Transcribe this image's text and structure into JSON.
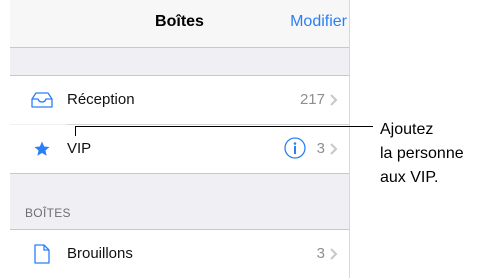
{
  "navbar": {
    "title": "Boîtes",
    "edit_label": "Modifier"
  },
  "mailboxes": [
    {
      "icon": "inbox-tray-icon",
      "label": "Réception",
      "count": "217"
    },
    {
      "icon": "star-icon",
      "label": "VIP",
      "count": "3"
    }
  ],
  "section_header": "BOÎTES",
  "boxes": [
    {
      "icon": "document-icon",
      "label": "Brouillons",
      "count": "3"
    }
  ],
  "callout": {
    "lines": [
      "Ajoutez",
      "la personne",
      "aux VIP."
    ]
  },
  "colors": {
    "accent": "#2a7ff6",
    "background": "#efeff4",
    "count_text": "#8e8e93"
  }
}
